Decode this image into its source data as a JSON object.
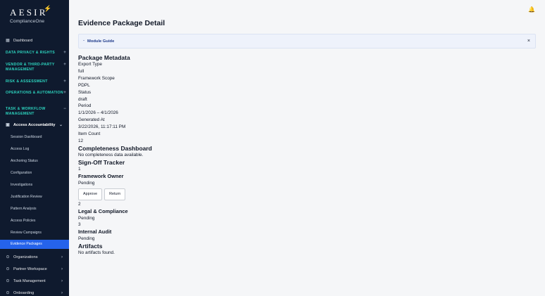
{
  "brand": {
    "name": "AESIR",
    "sub": "ComplianceOne"
  },
  "sidebar": {
    "dashboard": "Dashboard",
    "sections": [
      "DATA PRIVACY & RIGHTS",
      "VENDOR & THIRD-PARTY MANAGEMENT",
      "RISK & ASSESSMENT",
      "OPERATIONS & AUTOMATION",
      "TASK & WORKFLOW MANAGEMENT"
    ],
    "group": "Access Accountability",
    "sub_items": [
      "Session Dashboard",
      "Access Log",
      "Anchoring Status",
      "Configuration",
      "Investigations",
      "Justification Review",
      "Pattern Analysis",
      "Access Policies",
      "Review Campaigns"
    ],
    "active_item": "Evidence Packages",
    "bottom_items": [
      "Organizations",
      "Partner Workspace",
      "Task Management",
      "Onboarding"
    ]
  },
  "header": {
    "title": "Evidence Package Detail"
  },
  "guide": {
    "toggle": "-",
    "label": "Module Guide",
    "close": "×"
  },
  "metadata": {
    "heading": "Package Metadata",
    "fields": [
      {
        "label": "Export Type",
        "value": "full"
      },
      {
        "label": "Framework Scope",
        "value": "PDPL"
      },
      {
        "label": "Status",
        "value": "draft"
      },
      {
        "label": "Period",
        "value": "1/1/2026 – 4/1/2026"
      },
      {
        "label": "Generated At",
        "value": "3/22/2026, 11:17:11 PM"
      },
      {
        "label": "Item Count",
        "value": "12"
      }
    ]
  },
  "completeness": {
    "heading": "Completeness Dashboard",
    "message": "No completeness data available."
  },
  "signoff": {
    "heading": "Sign-Off Tracker",
    "steps": [
      {
        "number": "1",
        "title": "Framework Owner",
        "status": "Pending",
        "approve": "Approve",
        "return": "Return"
      },
      {
        "number": "2",
        "title": "Legal & Compliance",
        "status": "Pending"
      },
      {
        "number": "3",
        "title": "Internal Audit",
        "status": "Pending"
      }
    ]
  },
  "artifacts": {
    "heading": "Artifacts",
    "message": "No artifacts found."
  },
  "colors": {
    "sidebar_bg": "#0f1a2e",
    "accent": "#2563eb",
    "section_heading": "#2dd4bf",
    "bell": "#d97706"
  }
}
